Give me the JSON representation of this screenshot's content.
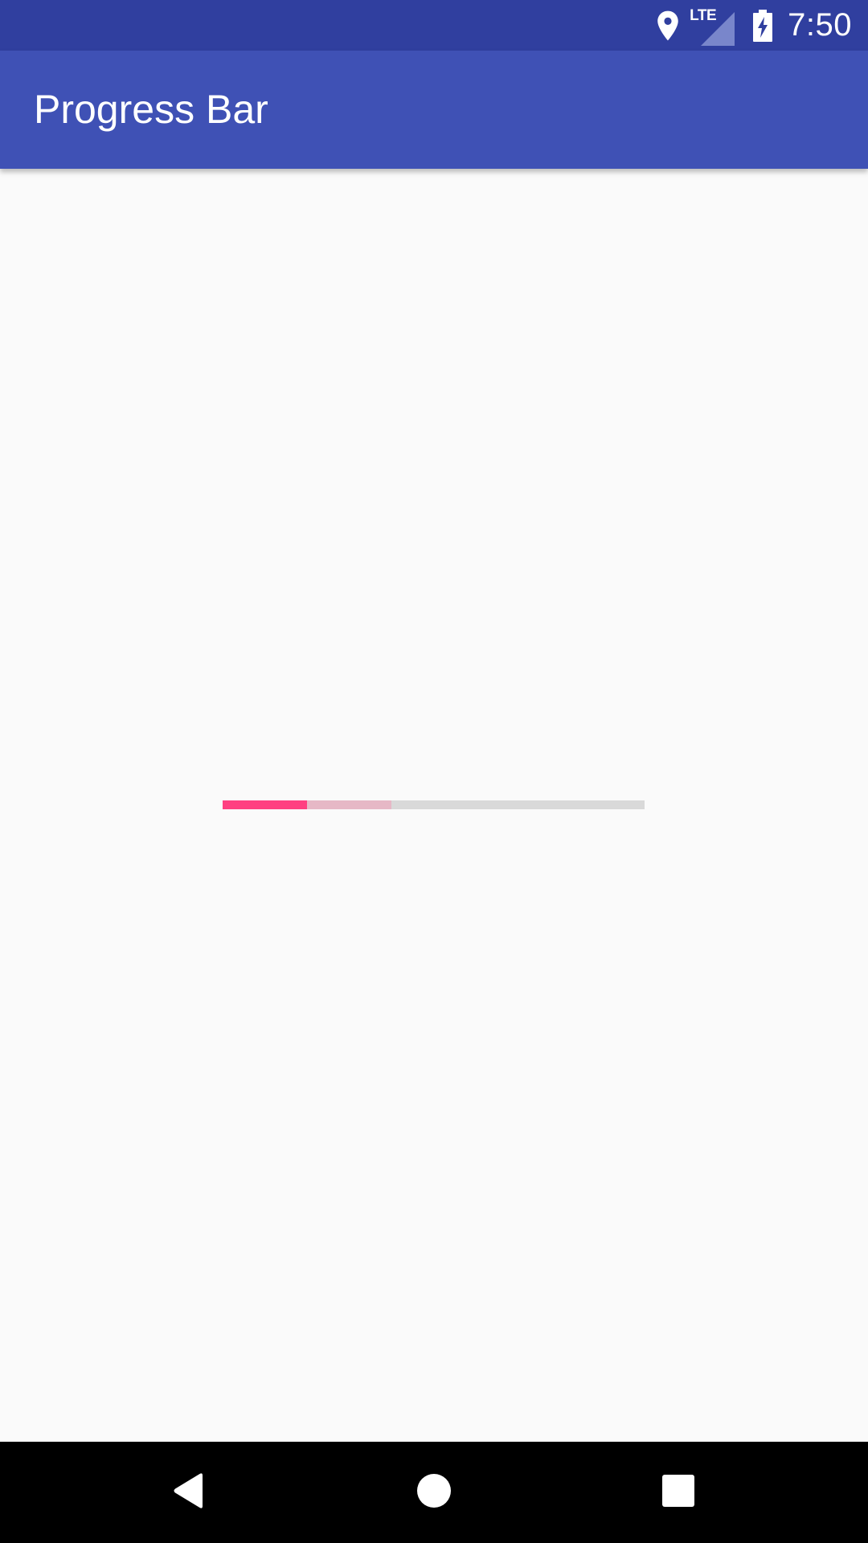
{
  "status_bar": {
    "time": "7:50",
    "network_label": "LTE",
    "icons": [
      "location-icon",
      "lte-signal-icon",
      "battery-charging-icon"
    ],
    "color": "#303f9f"
  },
  "app_bar": {
    "title": "Progress Bar",
    "color": "#3f51b5"
  },
  "progress": {
    "primary_fraction": 0.2,
    "secondary_fraction": 0.4,
    "primary_color": "#ff4081",
    "secondary_color": "#e6b8c6",
    "track_color": "#d9d9d9"
  },
  "nav_bar": {
    "icons": [
      "back-icon",
      "home-icon",
      "recents-icon"
    ]
  }
}
